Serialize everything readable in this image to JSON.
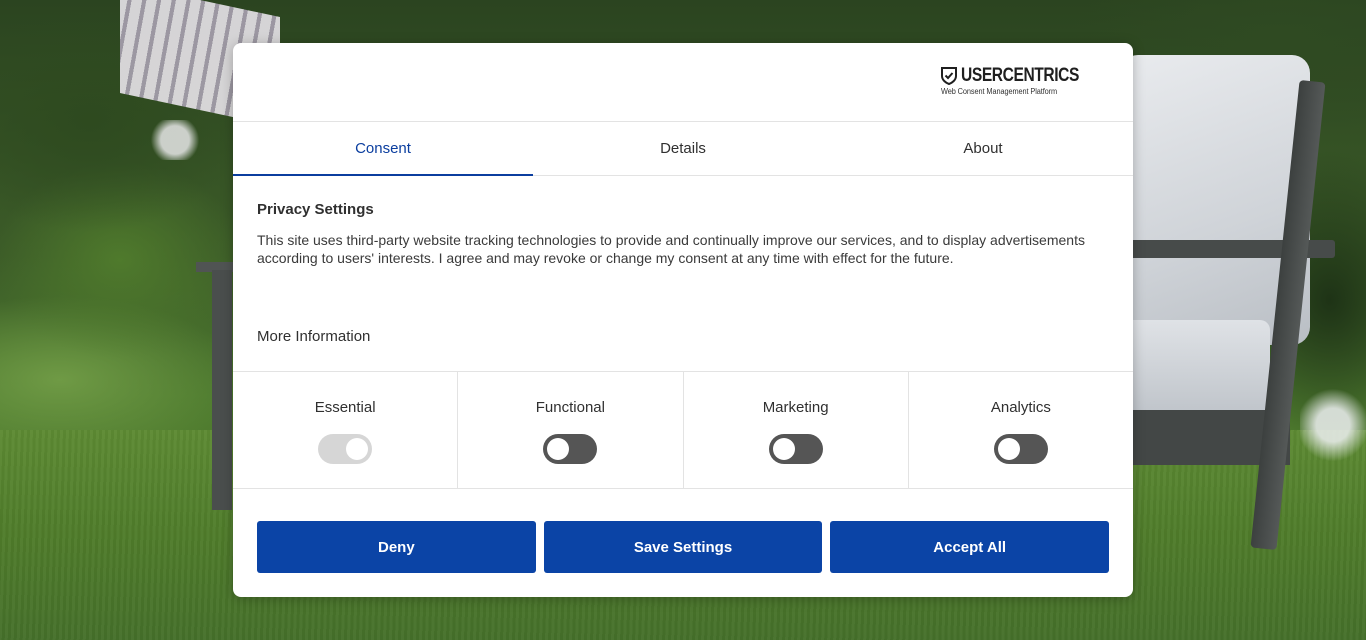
{
  "logo": {
    "name": "USERCENTRICS",
    "tagline": "Web Consent Management Platform"
  },
  "tabs": [
    {
      "label": "Consent",
      "active": true
    },
    {
      "label": "Details",
      "active": false
    },
    {
      "label": "About",
      "active": false
    }
  ],
  "privacy": {
    "title": "Privacy Settings",
    "body": "This site uses third-party website tracking technologies to provide and continually improve our services, and to display advertisements according to users' interests. I agree and may revoke or change my consent at any time with effect for the future.",
    "more_info": "More Information"
  },
  "categories": [
    {
      "label": "Essential",
      "enabled": true,
      "locked": true
    },
    {
      "label": "Functional",
      "enabled": false,
      "locked": false
    },
    {
      "label": "Marketing",
      "enabled": false,
      "locked": false
    },
    {
      "label": "Analytics",
      "enabled": false,
      "locked": false
    }
  ],
  "buttons": {
    "deny": "Deny",
    "save": "Save Settings",
    "accept": "Accept All"
  },
  "colors": {
    "accent": "#0b44a6",
    "active_tab": "#0b3e9f",
    "toggle_off": "#555555",
    "toggle_locked": "#d6d6d6"
  }
}
